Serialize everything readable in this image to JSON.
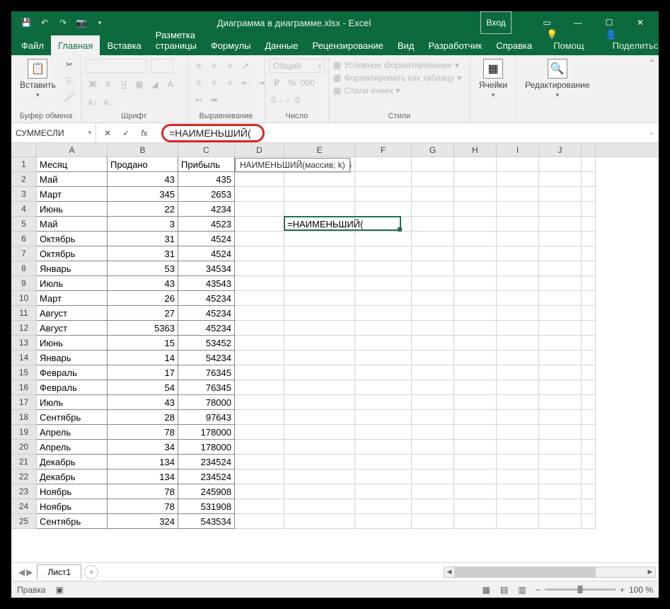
{
  "title": "Диаграмма в диаграмме.xlsx - Excel",
  "signin": "Вход",
  "ribbon": {
    "tabs": [
      "Файл",
      "Главная",
      "Вставка",
      "Разметка страницы",
      "Формулы",
      "Данные",
      "Рецензирование",
      "Вид",
      "Разработчик",
      "Справка"
    ],
    "help": "Помощ",
    "share": "Поделиться",
    "groups": {
      "clipboard": {
        "paste": "Вставить",
        "label": "Буфер обмена"
      },
      "font": {
        "label": "Шрифт"
      },
      "alignment": {
        "label": "Выравнивание"
      },
      "number": {
        "format": "Общий",
        "label": "Число"
      },
      "styles": {
        "cond": "Условное форматирование",
        "tbl": "Форматировать как таблицу",
        "cell": "Стили ячеек",
        "label": "Стили"
      },
      "cells": {
        "label": "Ячейки"
      },
      "editing": {
        "label": "Редактирование"
      }
    }
  },
  "namebox": "СУММЕСЛИ",
  "formula": "=НАИМЕНЬШИЙ(",
  "tooltip": "НАИМЕНЬШИЙ(массив; k)",
  "col_widths": {
    "A": 100,
    "B": 100,
    "C": 80,
    "D": 70,
    "E": 100,
    "F": 80,
    "G": 60,
    "H": 60,
    "I": 60,
    "J": 60,
    "K": 20
  },
  "columns": [
    "A",
    "B",
    "C",
    "D",
    "E",
    "F",
    "G",
    "H",
    "I",
    "J",
    ""
  ],
  "e1_value": "543534",
  "active_cell_formula": "=НАИМЕНЬШИЙ(",
  "rows": [
    {
      "n": 1,
      "a": "Месяц",
      "b": "Продано",
      "c": "Прибыль",
      "hdr": true
    },
    {
      "n": 2,
      "a": "Май",
      "b": "43",
      "c": "435"
    },
    {
      "n": 3,
      "a": "Март",
      "b": "345",
      "c": "2653"
    },
    {
      "n": 4,
      "a": "Июнь",
      "b": "22",
      "c": "4234"
    },
    {
      "n": 5,
      "a": "Май",
      "b": "3",
      "c": "4523"
    },
    {
      "n": 6,
      "a": "Октябрь",
      "b": "31",
      "c": "4524"
    },
    {
      "n": 7,
      "a": "Октябрь",
      "b": "31",
      "c": "4524"
    },
    {
      "n": 8,
      "a": "Январь",
      "b": "53",
      "c": "34534"
    },
    {
      "n": 9,
      "a": "Июль",
      "b": "43",
      "c": "43543"
    },
    {
      "n": 10,
      "a": "Март",
      "b": "26",
      "c": "45234"
    },
    {
      "n": 11,
      "a": "Август",
      "b": "27",
      "c": "45234"
    },
    {
      "n": 12,
      "a": "Август",
      "b": "5363",
      "c": "45234"
    },
    {
      "n": 13,
      "a": "Июнь",
      "b": "15",
      "c": "53452"
    },
    {
      "n": 14,
      "a": "Январь",
      "b": "14",
      "c": "54234"
    },
    {
      "n": 15,
      "a": "Февраль",
      "b": "17",
      "c": "76345"
    },
    {
      "n": 16,
      "a": "Февраль",
      "b": "54",
      "c": "76345"
    },
    {
      "n": 17,
      "a": "Июль",
      "b": "43",
      "c": "78000"
    },
    {
      "n": 18,
      "a": "Сентябрь",
      "b": "28",
      "c": "97643"
    },
    {
      "n": 19,
      "a": "Апрель",
      "b": "78",
      "c": "178000"
    },
    {
      "n": 20,
      "a": "Апрель",
      "b": "34",
      "c": "178000"
    },
    {
      "n": 21,
      "a": "Декабрь",
      "b": "134",
      "c": "234524"
    },
    {
      "n": 22,
      "a": "Декабрь",
      "b": "134",
      "c": "234524"
    },
    {
      "n": 23,
      "a": "Ноябрь",
      "b": "78",
      "c": "245908"
    },
    {
      "n": 24,
      "a": "Ноябрь",
      "b": "78",
      "c": "531908"
    },
    {
      "n": 25,
      "a": "Сентябрь",
      "b": "324",
      "c": "543534"
    }
  ],
  "sheet": "Лист1",
  "status": "Правка",
  "zoom": "100 %"
}
